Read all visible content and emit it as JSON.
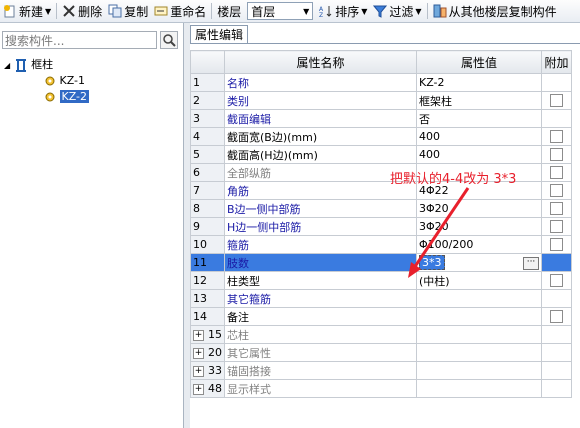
{
  "toolbar": {
    "new_label": "新建",
    "delete_label": "删除",
    "copy_label": "复制",
    "rename_label": "重命名",
    "floor_label": "楼层",
    "floor_value": "首层",
    "sort_label": "排序",
    "filter_label": "过滤",
    "copy_from_floor_label": "从其他楼层复制构件"
  },
  "left": {
    "search_placeholder": "搜索构件...",
    "tree_root": "框柱",
    "items": [
      "KZ-1",
      "KZ-2"
    ]
  },
  "right": {
    "tab_label": "属性编辑",
    "headers": {
      "name": "属性名称",
      "value": "属性值",
      "extra": "附加"
    },
    "rows": [
      {
        "no": "1",
        "name": "名称",
        "value": "KZ-2",
        "style": "blue",
        "check": false
      },
      {
        "no": "2",
        "name": "类别",
        "value": "框架柱",
        "style": "blue",
        "check": true
      },
      {
        "no": "3",
        "name": "截面编辑",
        "value": "否",
        "style": "blue",
        "check": false
      },
      {
        "no": "4",
        "name": "截面宽(B边)(mm)",
        "value": "400",
        "style": "black",
        "check": true
      },
      {
        "no": "5",
        "name": "截面高(H边)(mm)",
        "value": "400",
        "style": "black",
        "check": true
      },
      {
        "no": "6",
        "name": "全部纵筋",
        "value": "",
        "style": "gray",
        "check": true
      },
      {
        "no": "7",
        "name": "角筋",
        "value": "4Φ22",
        "style": "blue",
        "check": true
      },
      {
        "no": "8",
        "name": "B边一侧中部筋",
        "value": "3Φ20",
        "style": "blue",
        "check": true
      },
      {
        "no": "9",
        "name": "H边一侧中部筋",
        "value": "3Φ20",
        "style": "blue",
        "check": true
      },
      {
        "no": "10",
        "name": "箍筋",
        "value": "Φ100/200",
        "style": "blue",
        "check": true
      },
      {
        "no": "11",
        "name": "肢数",
        "value": "3*3",
        "style": "blue",
        "check": false
      },
      {
        "no": "12",
        "name": "柱类型",
        "value": "(中柱)",
        "style": "black",
        "check": true
      },
      {
        "no": "13",
        "name": "其它箍筋",
        "value": "",
        "style": "blue",
        "check": false
      },
      {
        "no": "14",
        "name": "备注",
        "value": "",
        "style": "black",
        "check": true
      },
      {
        "no": "15",
        "name": "芯柱",
        "value": "",
        "style": "gray-group",
        "check": false
      },
      {
        "no": "20",
        "name": "其它属性",
        "value": "",
        "style": "gray-group",
        "check": false
      },
      {
        "no": "33",
        "name": "锚固搭接",
        "value": "",
        "style": "gray-group",
        "check": false
      },
      {
        "no": "48",
        "name": "显示样式",
        "value": "",
        "style": "gray-group",
        "check": false
      }
    ]
  },
  "annotation": {
    "text": "把默认的4-4改为 3*3",
    "color": "#e8202c"
  },
  "colors": {
    "selection": "#3a7be0",
    "header_value_bg": "#f9c867",
    "name_blue": "#1a1aa6"
  }
}
